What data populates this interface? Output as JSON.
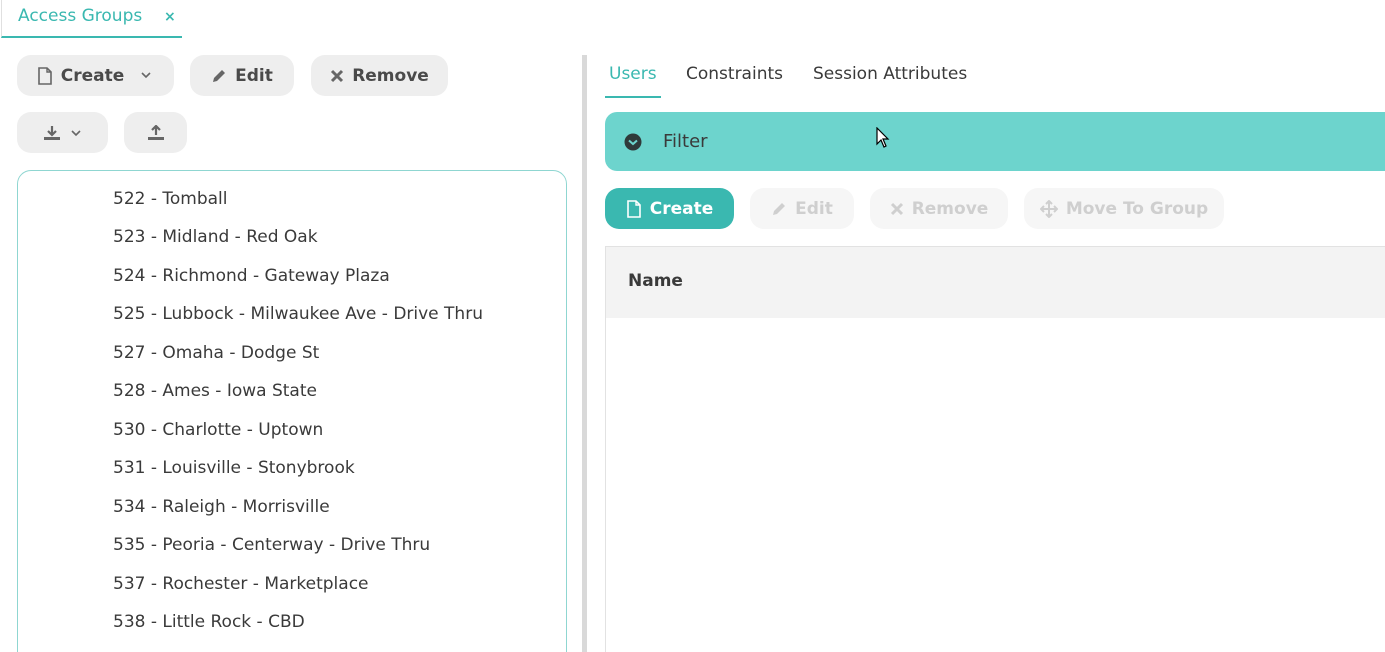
{
  "doc_tab": {
    "label": "Access Groups",
    "close": "×"
  },
  "left_toolbar": {
    "create_label": "Create",
    "edit_label": "Edit",
    "remove_label": "Remove"
  },
  "groups": [
    "522 - Tomball",
    "523 - Midland - Red Oak",
    "524 - Richmond - Gateway Plaza",
    "525 - Lubbock - Milwaukee Ave - Drive Thru",
    "527 - Omaha - Dodge St",
    "528 - Ames - Iowa State",
    "530 - Charlotte - Uptown",
    "531 - Louisville - Stonybrook",
    "534 - Raleigh - Morrisville",
    "535 - Peoria - Centerway - Drive Thru",
    "537 - Rochester - Marketplace",
    "538 - Little Rock - CBD"
  ],
  "right_tabs": [
    {
      "label": "Users",
      "active": true
    },
    {
      "label": "Constraints",
      "active": false
    },
    {
      "label": "Session Attributes",
      "active": false
    }
  ],
  "filter": {
    "label": "Filter"
  },
  "users_toolbar": {
    "create_label": "Create",
    "edit_label": "Edit",
    "remove_label": "Remove",
    "move_label": "Move To Group"
  },
  "grid": {
    "columns": [
      "Name"
    ]
  },
  "colors": {
    "accent": "#3ab8b0",
    "filter_bg": "#6dd4cd"
  }
}
